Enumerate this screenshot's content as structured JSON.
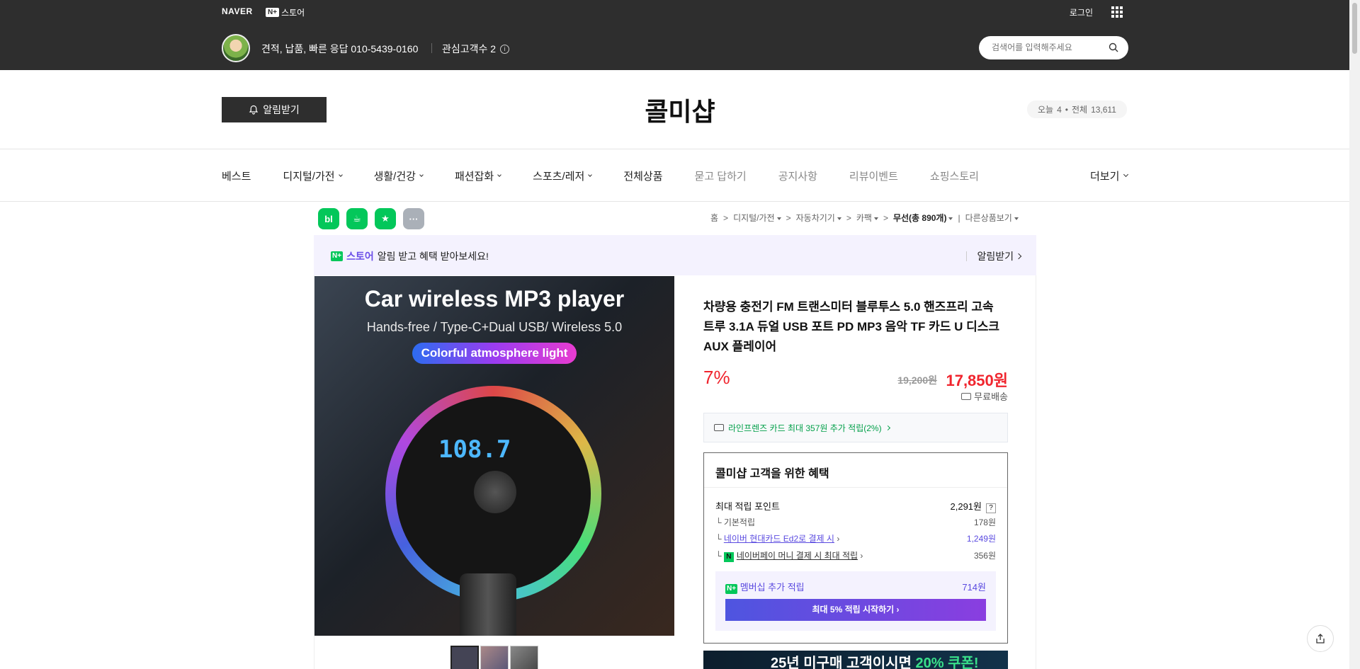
{
  "topbar": {
    "naver": "NAVER",
    "store_badge": "N+",
    "store_label": "스토어",
    "login": "로그인",
    "tagline": "견적, 납품, 빠른 응답 010-5439-0160",
    "interest": "관심고객수 2",
    "search_placeholder": "검색어를 입력해주세요"
  },
  "shop": {
    "alarm_button": "알림받기",
    "title": "콜미샵",
    "today_label": "오늘",
    "today_count": "4",
    "total_label": "전체",
    "total_count": "13,611"
  },
  "nav": {
    "items": [
      {
        "label": "베스트",
        "dropdown": false
      },
      {
        "label": "디지털/가전",
        "dropdown": true
      },
      {
        "label": "생활/건강",
        "dropdown": true
      },
      {
        "label": "패션잡화",
        "dropdown": true
      },
      {
        "label": "스포츠/레저",
        "dropdown": true
      },
      {
        "label": "전체상품",
        "dropdown": false
      },
      {
        "label": "묻고 답하기",
        "dropdown": false
      },
      {
        "label": "공지사항",
        "dropdown": false
      },
      {
        "label": "리뷰이벤트",
        "dropdown": false
      },
      {
        "label": "쇼핑스토리",
        "dropdown": false
      }
    ],
    "more": "더보기"
  },
  "share": {
    "blog": "bl",
    "cafe": "☕",
    "book": "★",
    "more": "···"
  },
  "breadcrumb": {
    "home": "홈",
    "c1": "디지털/가전",
    "c2": "자동차기기",
    "c3": "카팩",
    "c4": "무선(총 890개)",
    "c5": "다른상품보기"
  },
  "store_banner": {
    "badge": "N+",
    "store": "스토어",
    "message": "알림 받고 혜택 받아보세요!",
    "action": "알림받기"
  },
  "image": {
    "title": "Car wireless MP3 player",
    "subtitle": "Hands-free / Type-C+Dual USB/ Wireless 5.0",
    "pill": "Colorful atmosphere light",
    "lcd": "108.7"
  },
  "product": {
    "title": "차량용 충전기 FM 트랜스미터 블루투스 5.0 핸즈프리 고속 트루 3.1A 듀얼 USB 포트 PD MP3 음악 TF 카드 U 디스크 AUX 플레이어",
    "discount": "7%",
    "original_price": "19,200원",
    "sale_price": "17,850원",
    "shipping": "무료배송",
    "card_benefit": "라인프렌즈 카드 최대 357원 추가 적립(2%)"
  },
  "benefit": {
    "heading": "콜미샵 고객을 위한 혜택",
    "max_points_label": "최대 적립 포인트",
    "max_points_value": "2,291원",
    "rows": [
      {
        "label": "기본적립",
        "value": "178원"
      },
      {
        "label": "네이버 현대카드 Ed2로 결제 시",
        "value": "1,249원"
      },
      {
        "label": "네이버페이 머니 결제 시 최대 적립",
        "value": "356원"
      }
    ],
    "membership_label": "멤버십 추가 적립",
    "membership_value": "714원",
    "membership_button": "최대 5% 적립 시작하기"
  },
  "promo": {
    "text": "25년 미구매 고객이시면",
    "highlight": "20% 쿠폰!"
  },
  "colors": {
    "header_bg": "#2e2e2e",
    "accent_red": "#f0252e",
    "naver_green": "#03c75a",
    "purple": "#5a4ae0"
  }
}
